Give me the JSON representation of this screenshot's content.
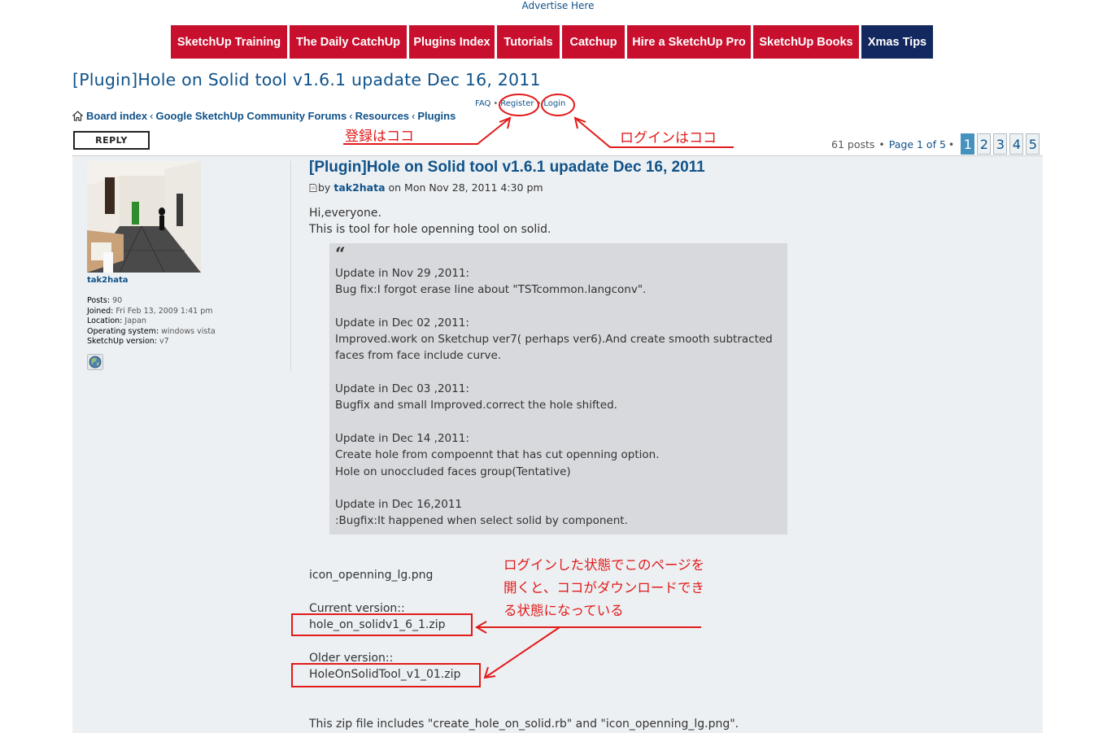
{
  "advertise": "Advertise Here",
  "nav": [
    {
      "label": "SketchUp Training"
    },
    {
      "label": "The Daily CatchUp"
    },
    {
      "label": "Plugins Index"
    },
    {
      "label": "Tutorials"
    },
    {
      "label": "Catchup"
    },
    {
      "label": "Hire a SketchUp Pro"
    },
    {
      "label": "SketchUp Books"
    },
    {
      "label": "Xmas Tips"
    }
  ],
  "page_title": "[Plugin]Hole on Solid tool v1.6.1 upadate Dec 16, 2011",
  "breadcrumb": {
    "items": [
      "Board index",
      "Google SketchUp Community Forums",
      "Resources",
      "Plugins"
    ],
    "sep": "‹"
  },
  "header_links": {
    "faq": "FAQ",
    "register": "Register",
    "login": "Login",
    "dot": "•"
  },
  "reply_label": "REPLY",
  "pagination": {
    "posts": "61 posts",
    "dot": "•",
    "page_of": "Page 1 of 5",
    "pages": [
      "1",
      "2",
      "3",
      "4",
      "5"
    ],
    "active": "1"
  },
  "profile": {
    "name": "tak2hata",
    "posts_label": "Posts:",
    "posts": "90",
    "joined_label": "Joined:",
    "joined": "Fri Feb 13, 2009 1:41 pm",
    "location_label": "Location:",
    "location": "Japan",
    "os_label": "Operating system:",
    "os": "windows vista",
    "su_label": "SketchUp version:",
    "su": "v7"
  },
  "post": {
    "title": "[Plugin]Hole on Solid tool v1.6.1 upadate Dec 16, 2011",
    "by": "by",
    "author": "tak2hata",
    "date": "on Mon Nov 28, 2011 4:30 pm",
    "greeting": "Hi,everyone.",
    "intro": "This is tool for hole openning tool on solid.",
    "quote": {
      "mark": "“",
      "u1_title": "Update in Nov 29 ,2011:",
      "u1_l1": "Bug fix:I forgot erase line about \"TSTcommon.langconv\".",
      "u2_title": "Update in Dec 02 ,2011:",
      "u2_l1": "Improved.work on Sketchup ver7( perhaps ver6).And create smooth subtracted",
      "u2_l2": "faces from face include curve.",
      "u3_title": "Update in Dec 03 ,2011:",
      "u3_l1": "Bugfix and small Improved.correct the hole shifted.",
      "u4_title": "Update in Dec 14 ,2011:",
      "u4_l1": "Create hole from compoennt that has cut openning option.",
      "u4_l2": "Hole on unoccluded faces group(Tentative)",
      "u5_title": "Update in Dec 16,2011",
      "u5_l1": ":Bugfix:It happened when select solid by component."
    },
    "icon_file": "icon_openning_lg.png",
    "current_label": "Current version::",
    "current_file": "hole_on_solidv1_6_1.zip",
    "older_label": "Older version::",
    "older_file": "HoleOnSolidTool_v1_01.zip",
    "includes": "This zip file includes \"create_hole_on_solid.rb\" and \"icon_openning_lg.png\"."
  },
  "annotations": {
    "register": "登録はココ",
    "login": "ログインはココ",
    "download_l1": "ログインした状態でこのページを",
    "download_l2": "開くと、ココがダウンロードでき",
    "download_l3": "る状態になっている",
    "color": "#e21a1a"
  },
  "colors": {
    "nav_red": "#c8102e",
    "nav_dark": "#12285e",
    "link_blue": "#105289",
    "post_bg": "#ecf0f3",
    "quote_bg": "#d7d9dc",
    "page_active": "#4692bf"
  }
}
